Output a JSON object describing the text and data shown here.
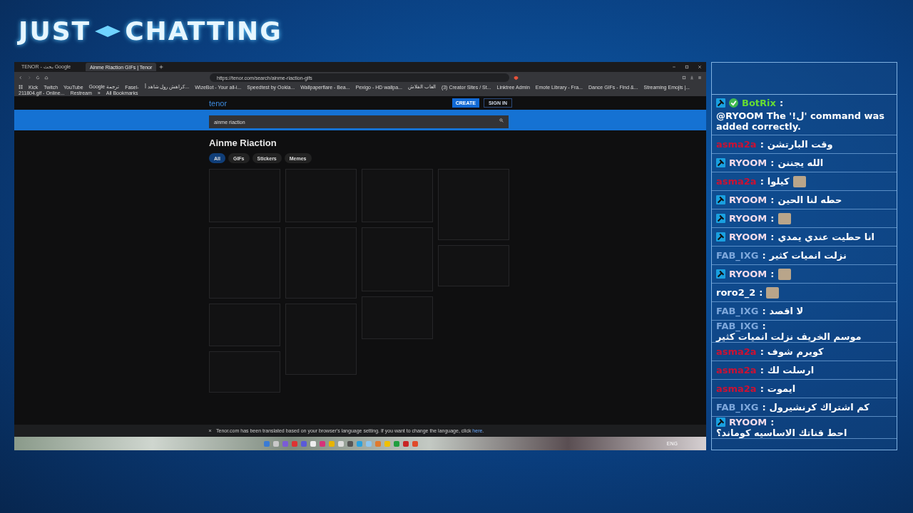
{
  "logo": {
    "left": "JUST",
    "right": "CHATTING"
  },
  "browser": {
    "tabs": [
      {
        "label": "TENOR - بحث Google",
        "selected": false
      },
      {
        "label": "Ainme Riaction GIFs | Tenor",
        "selected": true
      }
    ],
    "url": "https://tenor.com/search/ainme-riaction-gifs",
    "bookmarks": [
      "Kick",
      "Twitch",
      "YouTube",
      "Google ترجمة",
      "Fasel-",
      "كراهش رول شاهد أ...",
      "WizeBot - Your all-i...",
      "Speedtest by Ookla...",
      "Wallpaperflare - Bea...",
      "Pexigo - HD wallpa...",
      "العاب الفلاش",
      "(3) Creator Sites / St...",
      "Linktree Admin",
      "Emote Library - Fra...",
      "Dance GIFs - Find &...",
      "Streaming Emojis |...",
      "211804.gif - Online...",
      "Restream"
    ],
    "more_bookmarks": "»",
    "all_bookmarks": "All Bookmarks"
  },
  "tenor": {
    "logo": "tenor",
    "create": "CREATE",
    "sign_in": "SIGN IN",
    "search_value": "ainme riaction",
    "heading": "Ainme Riaction",
    "filters": [
      {
        "label": "All",
        "selected": true
      },
      {
        "label": "GIFs",
        "selected": false
      },
      {
        "label": "Stickers",
        "selected": false
      },
      {
        "label": "Memes",
        "selected": false
      }
    ]
  },
  "notice": {
    "text": "Tenor.com has been translated based on your browser's language setting. If you want to change the language, click ",
    "link": "here",
    "after": "."
  },
  "taskbar": {
    "language": "ENG"
  },
  "chat": [
    {
      "user": "BotRix",
      "color": "#66dd33",
      "mod": true,
      "verified": true,
      "sep": ":",
      "text": "@RYOOM The '!ل' command was added correctly.",
      "emote": false
    },
    {
      "user": "asma2a",
      "color": "#cc1133",
      "mod": false,
      "verified": false,
      "sep": ":",
      "text": "وقت البارتشن",
      "emote": false
    },
    {
      "user": "RYOOM",
      "color": "#f3dcea",
      "mod": true,
      "verified": false,
      "sep": ":",
      "text": "الله يجننن",
      "emote": false
    },
    {
      "user": "asma2a",
      "color": "#cc1133",
      "mod": false,
      "verified": false,
      "sep": ":",
      "text": "كيلوا",
      "emote": true
    },
    {
      "user": "RYOOM",
      "color": "#f3dcea",
      "mod": true,
      "verified": false,
      "sep": ":",
      "text": "حطه لنا الحين",
      "emote": false
    },
    {
      "user": "RYOOM",
      "color": "#f3dcea",
      "mod": true,
      "verified": false,
      "sep": ":",
      "emote": true
    },
    {
      "user": "RYOOM",
      "color": "#f3dcea",
      "mod": true,
      "verified": false,
      "sep": ":",
      "text": "انا حطيت عندي يمدي",
      "emote": false
    },
    {
      "user": "FAB_IXG",
      "color": "#7ea8dc",
      "mod": false,
      "verified": false,
      "sep": ":",
      "text": "نزلت انميات كثير",
      "emote": false
    },
    {
      "user": "RYOOM",
      "color": "#f3dcea",
      "mod": true,
      "verified": false,
      "sep": ":",
      "emote": true
    },
    {
      "user": "roro2_2",
      "color": "#ffffff",
      "mod": false,
      "verified": false,
      "sep": ":",
      "emote": true
    },
    {
      "user": "FAB_IXG",
      "color": "#7ea8dc",
      "mod": false,
      "verified": false,
      "sep": ":",
      "text": "لا اقصد",
      "emote": false
    },
    {
      "user": "FAB_IXG",
      "color": "#7ea8dc",
      "mod": false,
      "verified": false,
      "sep": ":",
      "text": "موسم الخريف نزلت انميات كثير",
      "emote": false
    },
    {
      "user": "asma2a",
      "color": "#cc1133",
      "mod": false,
      "verified": false,
      "sep": ":",
      "text": "كويرم شوف",
      "emote": false
    },
    {
      "user": "asma2a",
      "color": "#cc1133",
      "mod": false,
      "verified": false,
      "sep": ":",
      "text": "ارسلت لك",
      "emote": false
    },
    {
      "user": "asma2a",
      "color": "#cc1133",
      "mod": false,
      "verified": false,
      "sep": ":",
      "text": "ايموت",
      "emote": false
    },
    {
      "user": "FAB_IXG",
      "color": "#7ea8dc",
      "mod": false,
      "verified": false,
      "sep": ":",
      "text": "كم اشتراك كرنشيرول",
      "emote": false
    },
    {
      "user": "RYOOM",
      "color": "#f3dcea",
      "mod": true,
      "verified": false,
      "sep": ":",
      "text": "احط قناتك الاساسيه كوماند؟",
      "emote": false
    }
  ]
}
